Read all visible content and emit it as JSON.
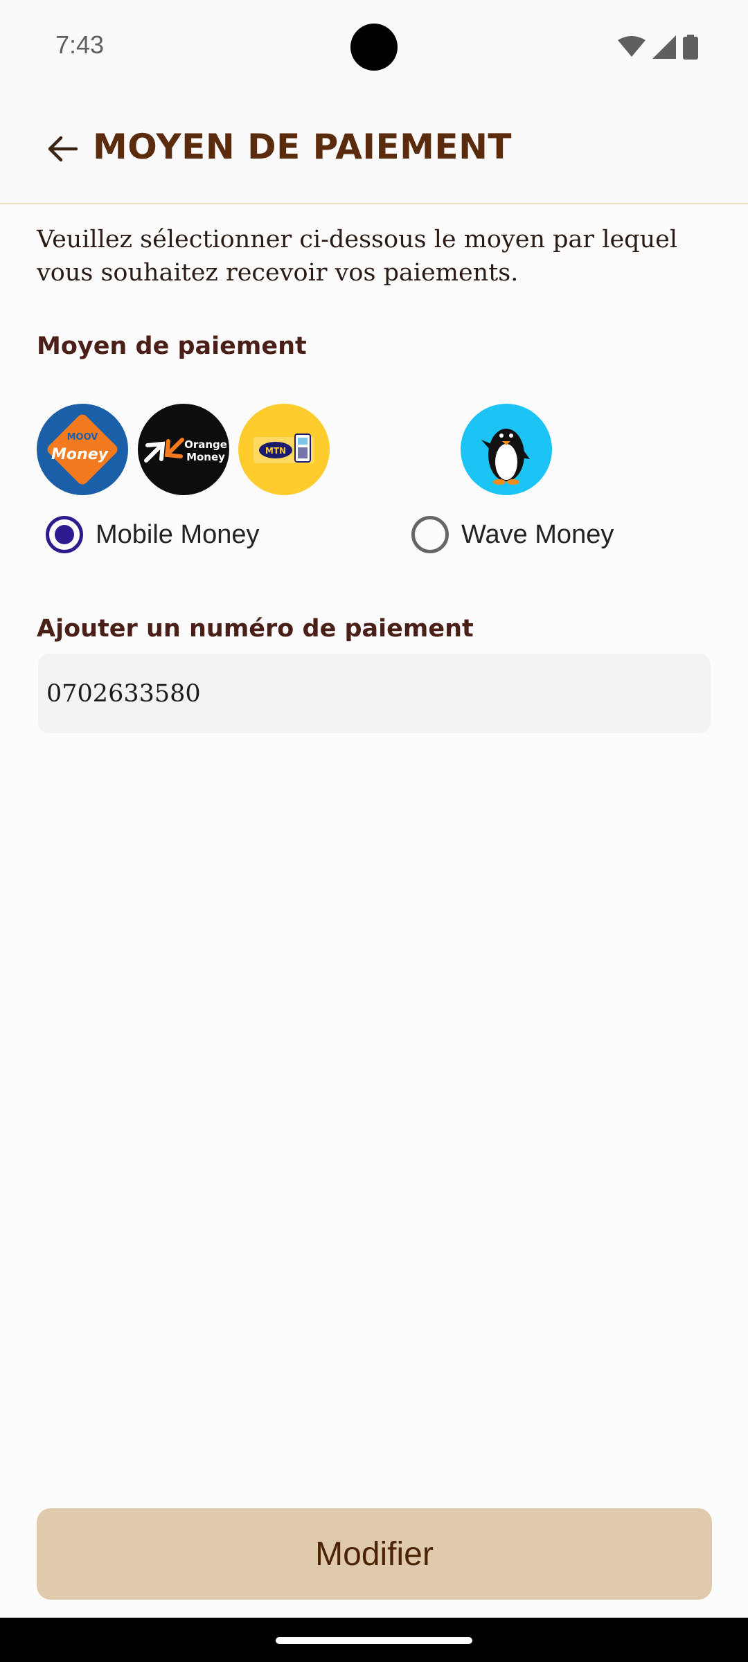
{
  "status_bar": {
    "time": "7:43"
  },
  "header": {
    "title": "MOYEN DE PAIEMENT"
  },
  "intro": {
    "text": "Veuillez sélectionner ci-dessous le moyen par lequel vous souhaitez recevoir vos paiements."
  },
  "payment_method": {
    "label": "Moyen de paiement",
    "options": [
      {
        "label": "Mobile Money",
        "selected": true
      },
      {
        "label": "Wave Money",
        "selected": false
      }
    ],
    "logos": {
      "moov": {
        "line1": "MOOV",
        "line2": "Money"
      },
      "orange": {
        "line1": "Orange",
        "line2": "Money"
      },
      "mtn": {
        "text": "MTN"
      },
      "wave": {
        "icon": "penguin-icon"
      }
    }
  },
  "payment_number": {
    "label": "Ajouter un numéro de paiement",
    "value": "0702633580"
  },
  "actions": {
    "modify_label": "Modifier"
  },
  "colors": {
    "title": "#5a2b0d",
    "radio_selected": "#2c1b8f",
    "button_bg": "#dfcaae",
    "button_text": "#4b2405"
  }
}
